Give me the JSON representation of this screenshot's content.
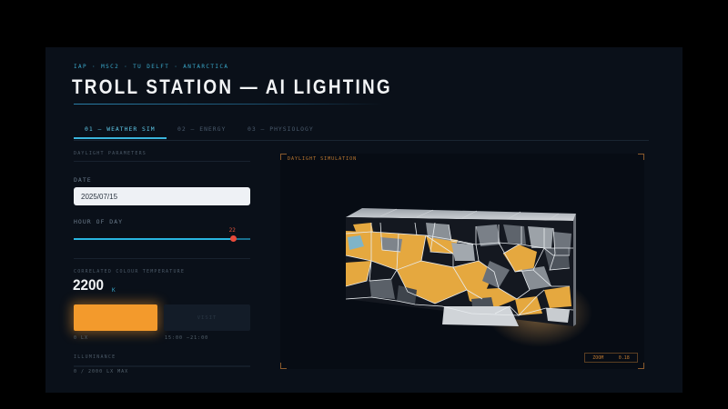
{
  "header": {
    "breadcrumb": "IAP · MSC2 · TU DELFT · ANTARCTICA",
    "title": "TROLL STATION — AI LIGHTING"
  },
  "tabs": [
    {
      "label": "01 — WEATHER SIM",
      "active": true
    },
    {
      "label": "02 — ENERGY",
      "active": false
    },
    {
      "label": "03 — PHYSIOLOGY",
      "active": false
    }
  ],
  "daylight": {
    "section_label": "DAYLIGHT PARAMETERS",
    "date_label": "DATE",
    "date_value": "2025/07/15",
    "hour_label": "HOUR OF DAY",
    "hour_value": "22",
    "hour_fraction": 0.9
  },
  "cct": {
    "label": "CORRELATED COLOUR TEMPERATURE",
    "value": "2200",
    "unit": "K",
    "lamp_color": "#f39a2c",
    "visit_label": "VISIT",
    "left_caption": "0 LX",
    "right_caption": "15:00 –21:00"
  },
  "illuminance": {
    "label": "ILLUMINANCE",
    "range_text": "0 / 2000 LX MAX",
    "fraction": 0
  },
  "simulation": {
    "label": "DAYLIGHT SIMULATION",
    "zoom_label": "ZOOM",
    "zoom_value": "0.18",
    "accent": "#f5a623"
  }
}
